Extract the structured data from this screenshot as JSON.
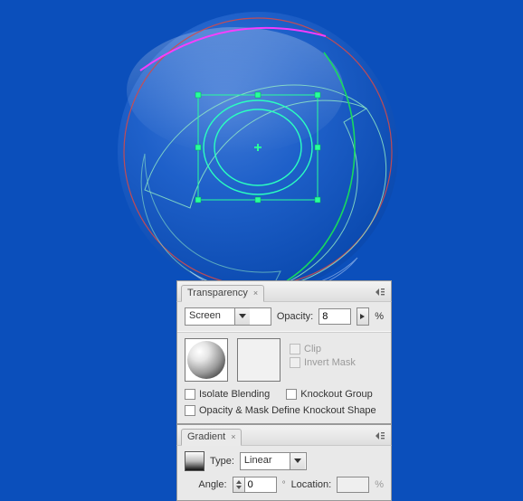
{
  "canvas": {
    "bg": "#0b4fbb"
  },
  "transparency_panel": {
    "title": "Transparency",
    "blend_mode": {
      "selected": "Screen"
    },
    "opacity": {
      "label": "Opacity:",
      "value": "8",
      "unit": "%"
    },
    "mask": {
      "clip": {
        "label": "Clip",
        "checked": false
      },
      "invert": {
        "label": "Invert Mask",
        "checked": false
      }
    },
    "options": {
      "isolate": {
        "label": "Isolate Blending",
        "checked": false
      },
      "knockout": {
        "label": "Knockout Group",
        "checked": false
      },
      "define_knockout": {
        "label": "Opacity & Mask Define Knockout Shape",
        "checked": false
      }
    }
  },
  "gradient_panel": {
    "title": "Gradient",
    "type": {
      "label": "Type:",
      "selected": "Linear"
    },
    "angle": {
      "label": "Angle:",
      "value": "0"
    },
    "location": {
      "label": "Location:",
      "value": "",
      "unit": "%"
    }
  }
}
